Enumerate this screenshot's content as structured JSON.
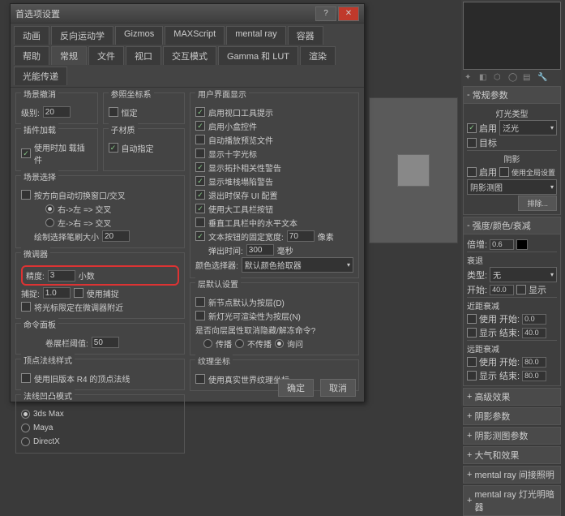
{
  "title": "首选项设置",
  "tabs_r1": [
    "动画",
    "反向运动学",
    "Gizmos",
    "MAXScript",
    "mental ray",
    "容器",
    "帮助"
  ],
  "tabs_r2": [
    "常规",
    "文件",
    "视口",
    "交互模式",
    "Gamma 和 LUT",
    "渲染",
    "光能传递"
  ],
  "scene_undo": {
    "title": "场景撤消",
    "levels": "级别:",
    "val": "20"
  },
  "ref_coord": {
    "title": "参照坐标系",
    "constant": "恒定"
  },
  "plugin": {
    "title": "插件加载",
    "load": "使用时加\n载插件"
  },
  "subm": {
    "title": "子材质",
    "auto": "自动指定"
  },
  "scene_sel": {
    "title": "场景选择",
    "auto": "按方向自动切换窗口/交叉",
    "rl": "右->左 => 交叉",
    "lr": "左->右 => 交叉",
    "brush": "绘制选择笔刷大小",
    "bval": "20"
  },
  "spinner": {
    "title": "微调器",
    "prec": "精度:",
    "pval": "3",
    "dec": "小数",
    "snap": "捕捉:",
    "sval": "1.0",
    "usesnap": "使用捕捉",
    "lock": "将光标限定在微调器附近"
  },
  "cmd": {
    "title": "命令面板",
    "thresh": "卷展栏阈值:",
    "val": "50"
  },
  "vn": {
    "title": "顶点法线样式",
    "r4": "使用旧版本 R4 的顶点法线"
  },
  "nm": {
    "title": "法线凹凸模式",
    "m1": "3ds Max",
    "m2": "Maya",
    "m3": "DirectX"
  },
  "ui": {
    "title": "用户界面显示",
    "i1": "启用视口工具提示",
    "i2": "启用小盒控件",
    "i3": "自动播放预览文件",
    "i4": "显示十字光标",
    "i5": "显示拓扑相关性警告",
    "i6": "显示堆栈塌陷警告",
    "i7": "退出时保存 UI 配置",
    "i8": "使用大工具栏按钮",
    "i9": "垂直工具栏中的水平文本",
    "i10": "文本按钮的固定宽度:",
    "w": "70",
    "px": "像素",
    "fly": "弹出时间:",
    "ft": "300",
    "ms": "毫秒",
    "cp": "颜色选择器:",
    "cpv": "默认颜色拾取器"
  },
  "layer": {
    "title": "层默认设置",
    "l1": "新节点默认为按层(D)",
    "l2": "新灯光可渲染性为按层(N)",
    "l3": "是否向层属性取消隐藏/解冻命令?",
    "p": "传播",
    "np": "不传播",
    "ask": "询问"
  },
  "tex": {
    "title": "纹理坐标",
    "rw": "使用真实世界纹理坐标"
  },
  "ok": "确定",
  "cancel": "取消",
  "sp": {
    "r0": "常规参数",
    "r1": "灯光类型",
    "on": "启用",
    "type": "泛光",
    "targ": "目标",
    "r2": "阴影",
    "shon": "启用",
    "glob": "使用全局设置",
    "map": "阴影测图",
    "excl": "排除...",
    "r3": "强度/颜色/衰减",
    "mult": "倍增:",
    "mv": "0.6",
    "decay": "衰退",
    "dtype": "类型:",
    "dnone": "无",
    "start": "开始:",
    "sv": "40.0",
    "show": "显示",
    "r4": "近距衰减",
    "use": "使用",
    "ust": "开始:",
    "uv": "0.0",
    "sh": "显示",
    "end": "结束:",
    "ev": "40.0",
    "r5": "远距衰减",
    "fst": "开始:",
    "fv": "80.0",
    "fend": "结束:",
    "fev": "80.0",
    "rolls": [
      "高级效果",
      "阴影参数",
      "阴影测图参数",
      "大气和效果",
      "mental ray 间接照明",
      "mental ray 灯光明暗器"
    ]
  }
}
